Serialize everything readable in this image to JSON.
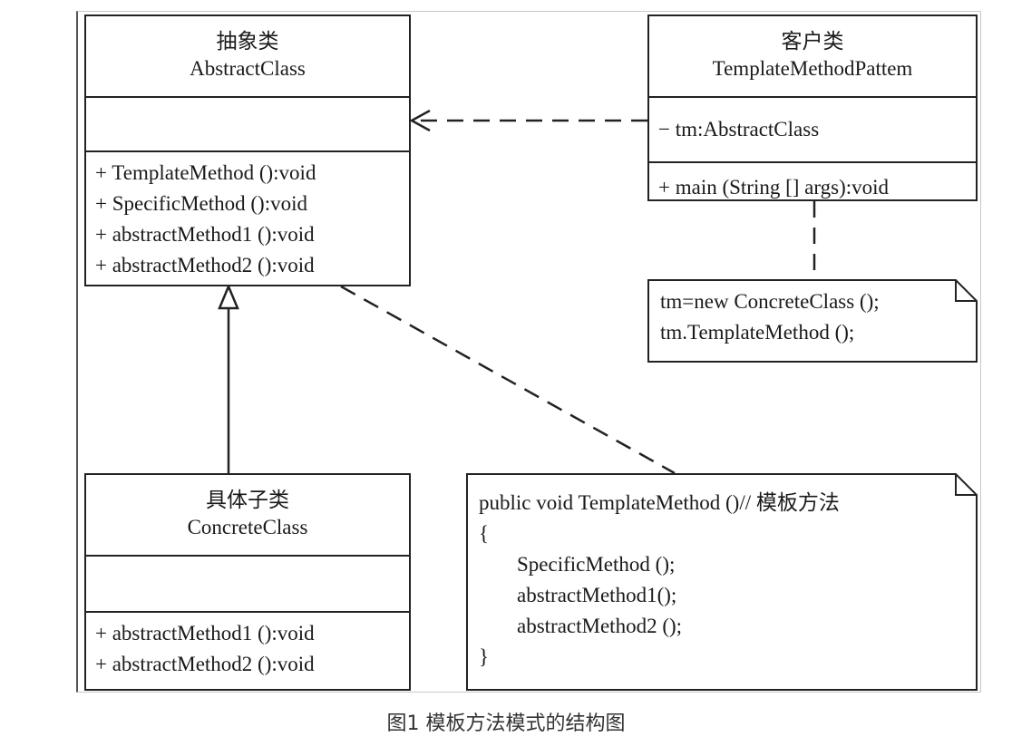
{
  "abstract_class": {
    "name_cn": "抽象类",
    "name_en": "AbstractClass",
    "attributes": [],
    "methods": [
      "+ TemplateMethod ():void",
      "+ SpecificMethod ():void",
      "+ abstractMethod1 ():void",
      "+ abstractMethod2 ():void"
    ]
  },
  "client_class": {
    "name_cn": "客户类",
    "name_en": "TemplateMethodPattem",
    "attributes": [
      "− tm:AbstractClass"
    ],
    "methods": [
      "+ main (String [] args):void"
    ]
  },
  "concrete_class": {
    "name_cn": "具体子类",
    "name_en": "ConcreteClass",
    "attributes": [],
    "methods": [
      "+ abstractMethod1 ():void",
      "+ abstractMethod2 ():void"
    ]
  },
  "client_note": {
    "lines": [
      "tm=new ConcreteClass ();",
      "tm.TemplateMethod ();"
    ]
  },
  "template_note": {
    "lines": [
      "public void TemplateMethod ()// 模板方法",
      "{",
      "SpecificMethod ();",
      "abstractMethod1();",
      "abstractMethod2 ();",
      "}"
    ]
  },
  "caption": "图1 模板方法模式的结构图"
}
